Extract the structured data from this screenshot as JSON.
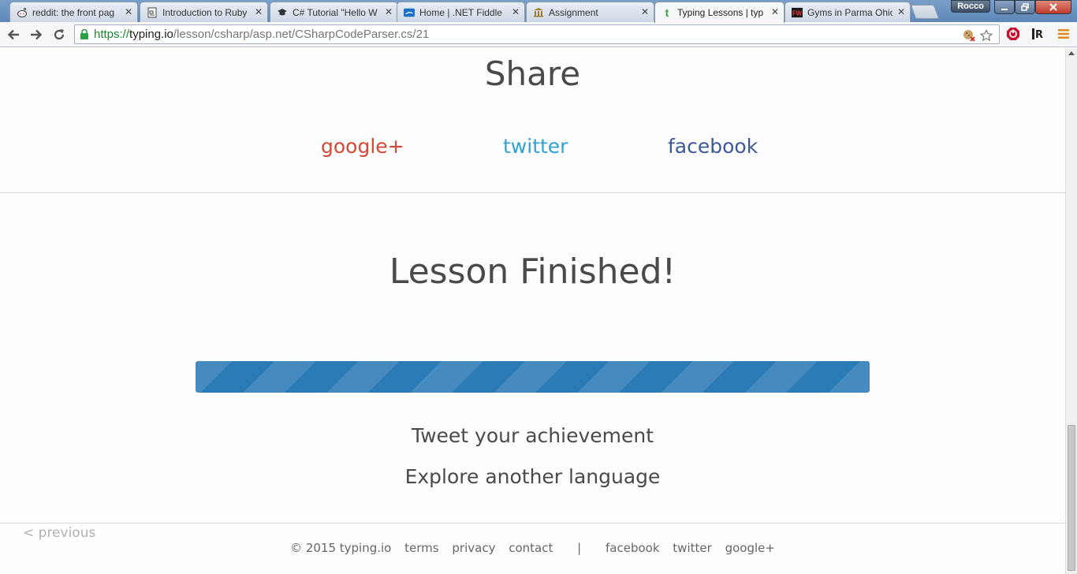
{
  "browser": {
    "tabs": [
      {
        "title": "reddit: the front pag",
        "icon": "reddit-icon",
        "active": false
      },
      {
        "title": "Introduction to Ruby",
        "icon": "document-icon",
        "active": false
      },
      {
        "title": "C# Tutorial \"Hello W",
        "icon": "graduation-cap-icon",
        "active": false
      },
      {
        "title": "Home | .NET Fiddle",
        "icon": "dotnetfiddle-icon",
        "active": false
      },
      {
        "title": "Assignment",
        "icon": "building-icon",
        "active": false
      },
      {
        "title": "Typing Lessons | typ",
        "icon": "typing-io-icon",
        "active": true
      },
      {
        "title": "Gyms in Parma Ohio",
        "icon": "fw-icon",
        "active": false
      }
    ],
    "profile_name": "Rocco",
    "url": {
      "scheme": "https://",
      "host": "typing.io",
      "path": "/lesson/csharp/asp.net/CSharpCodeParser.cs/21"
    },
    "extensions": {
      "adblock_label": "⏻",
      "readability_label": "R"
    }
  },
  "page": {
    "share": {
      "title": "Share",
      "google": "google+",
      "twitter": "twitter",
      "facebook": "facebook"
    },
    "lesson_title": "Lesson Finished!",
    "progress_fraction": 1.0,
    "tweet_label": "Tweet your achievement",
    "explore_label": "Explore another language",
    "previous_label": "< previous",
    "footer": {
      "copyright": "© 2015 typing.io",
      "terms": "terms",
      "privacy": "privacy",
      "contact": "contact",
      "separator": "|",
      "facebook": "facebook",
      "twitter": "twitter",
      "google": "google+"
    }
  },
  "colors": {
    "google": "#d34836",
    "twitter": "#2ea1d7",
    "facebook": "#3b5998",
    "progress": "#2a7ab6",
    "secure": "#1a8a34"
  }
}
